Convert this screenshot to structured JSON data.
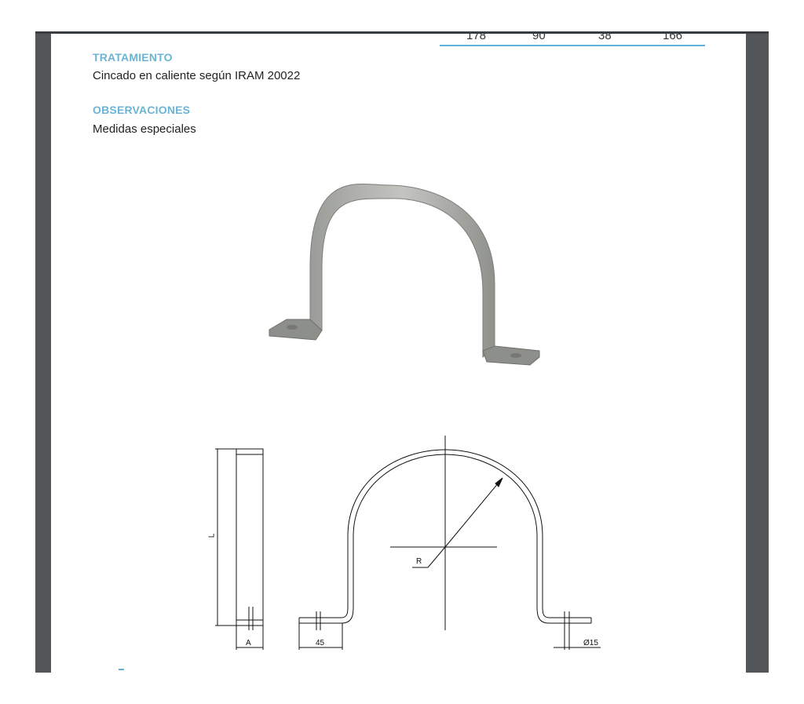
{
  "table": {
    "values": [
      "178",
      "90",
      "38",
      "166"
    ]
  },
  "sections": {
    "treatment_title": "TRATAMIENTO",
    "treatment_text": "Cincado en caliente según IRAM 20022",
    "observations_title": "OBSERVACIONES",
    "observations_text": "Medidas especiales"
  },
  "drawing": {
    "label_l": "L",
    "label_a": "A",
    "label_45": "45",
    "label_r": "R",
    "label_hole": "Ø15"
  }
}
